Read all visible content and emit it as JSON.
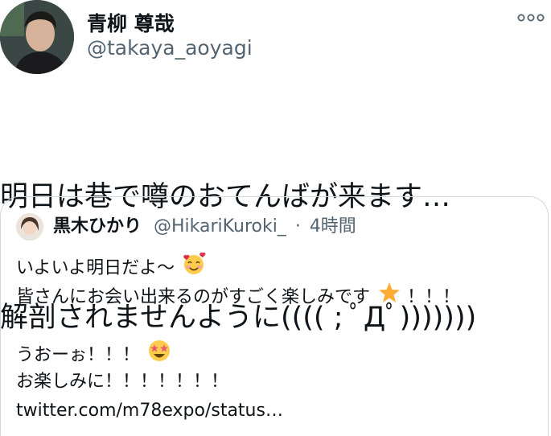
{
  "tweet": {
    "author": {
      "display_name": "青柳 尊哉",
      "handle": "@takaya_aoyagi"
    },
    "more_icon": "more-dots-icon",
    "text_lines": [
      "明日は巷で噂のおてんばが来ます…",
      "解剖されませんように(((( ; ﾟДﾟ)))))))"
    ]
  },
  "quote": {
    "author": {
      "display_name": "黒木ひかり",
      "handle": "@HikariKuroki_",
      "separator": "·",
      "time": "4時間"
    },
    "lines": [
      {
        "text": "いよいよ明日だよ〜",
        "emoji": "smiling-face-with-hearts"
      },
      {
        "text": "皆さんにお会い出来るのがすごく楽しみです",
        "emoji": "star",
        "after": "！！！"
      },
      {
        "text": ""
      },
      {
        "text": "うおーぉ！！！",
        "emoji": "star-struck"
      },
      {
        "text": "お楽しみに！！！！！！！"
      }
    ],
    "link": "twitter.com/m78expo/status…"
  },
  "colors": {
    "text": "#0f1419",
    "secondary": "#536471",
    "border": "#cfd9de"
  }
}
